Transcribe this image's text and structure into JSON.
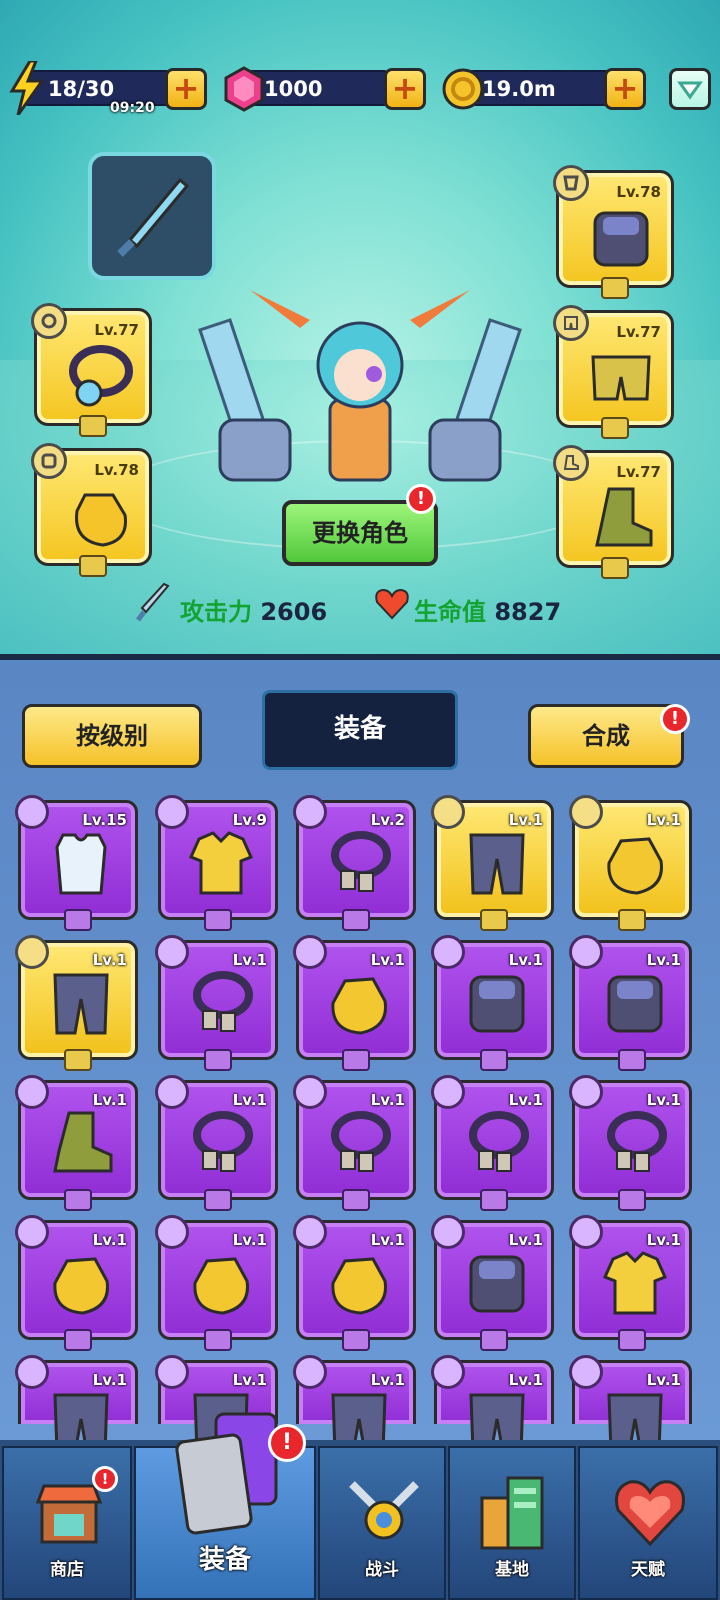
{
  "resources": {
    "energy": "18/30",
    "energy_timer": "09:20",
    "gems": "1000",
    "gold": "19.0m",
    "plus": "+"
  },
  "character": {
    "change_button": "更换角色",
    "alert": "!",
    "attack_label": "攻击力",
    "attack_value": "2606",
    "hp_label": "生命值",
    "hp_value": "8827"
  },
  "equipped": {
    "necklace_lv": "Lv.77",
    "gloves_lv": "Lv.78",
    "armor_lv": "Lv.78",
    "pants_lv": "Lv.77",
    "boots_lv": "Lv.77"
  },
  "inventory": {
    "sort_button": "按级别",
    "title": "装备",
    "merge_button": "合成",
    "items": [
      {
        "lv": "Lv.15",
        "kind": "vest",
        "rarity": "purple"
      },
      {
        "lv": "Lv.9",
        "kind": "shirt",
        "rarity": "purple"
      },
      {
        "lv": "Lv.2",
        "kind": "necklace",
        "rarity": "purple"
      },
      {
        "lv": "Lv.1",
        "kind": "pants",
        "rarity": "gold"
      },
      {
        "lv": "Lv.1",
        "kind": "gloves",
        "rarity": "gold"
      },
      {
        "lv": "Lv.1",
        "kind": "pants",
        "rarity": "gold"
      },
      {
        "lv": "Lv.1",
        "kind": "necklace",
        "rarity": "purple"
      },
      {
        "lv": "Lv.1",
        "kind": "gloves",
        "rarity": "purple"
      },
      {
        "lv": "Lv.1",
        "kind": "armor",
        "rarity": "purple"
      },
      {
        "lv": "Lv.1",
        "kind": "armor",
        "rarity": "purple"
      },
      {
        "lv": "Lv.1",
        "kind": "boots",
        "rarity": "purple"
      },
      {
        "lv": "Lv.1",
        "kind": "necklace",
        "rarity": "purple"
      },
      {
        "lv": "Lv.1",
        "kind": "necklace",
        "rarity": "purple"
      },
      {
        "lv": "Lv.1",
        "kind": "necklace",
        "rarity": "purple"
      },
      {
        "lv": "Lv.1",
        "kind": "necklace",
        "rarity": "purple"
      },
      {
        "lv": "Lv.1",
        "kind": "gloves",
        "rarity": "purple"
      },
      {
        "lv": "Lv.1",
        "kind": "gloves",
        "rarity": "purple"
      },
      {
        "lv": "Lv.1",
        "kind": "gloves",
        "rarity": "purple"
      },
      {
        "lv": "Lv.1",
        "kind": "armor",
        "rarity": "purple"
      },
      {
        "lv": "Lv.1",
        "kind": "shirt",
        "rarity": "purple"
      },
      {
        "lv": "Lv.1",
        "kind": "pants",
        "rarity": "purple"
      },
      {
        "lv": "Lv.1",
        "kind": "pants",
        "rarity": "purple"
      },
      {
        "lv": "Lv.1",
        "kind": "pants",
        "rarity": "purple"
      },
      {
        "lv": "Lv.1",
        "kind": "pants",
        "rarity": "purple"
      },
      {
        "lv": "Lv.1",
        "kind": "pants",
        "rarity": "purple"
      }
    ]
  },
  "nav": {
    "shop": "商店",
    "equipment": "装备",
    "battle": "战斗",
    "base": "基地",
    "talent": "天赋"
  },
  "colors": {
    "purple_rarity": "#9b3fe0",
    "gold_rarity": "#f4c51f",
    "alert_red": "#e8262b"
  }
}
